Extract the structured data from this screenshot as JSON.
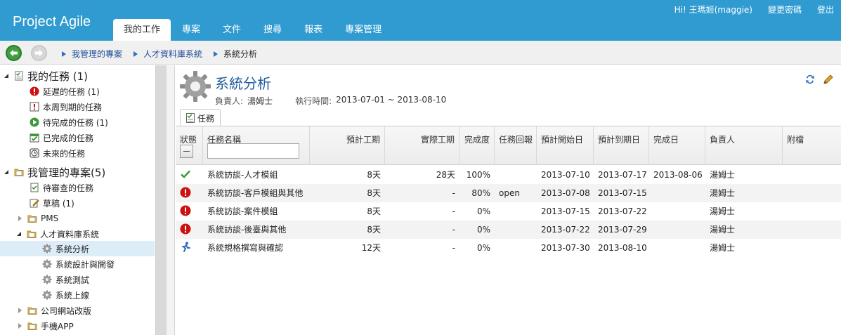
{
  "app": {
    "title": "Project Agile"
  },
  "user": {
    "greeting": "Hi! 王瑪姬(maggie)",
    "change_password": "變更密碼",
    "logout": "登出"
  },
  "tabs": [
    {
      "label": "我的工作",
      "active": true
    },
    {
      "label": "專案"
    },
    {
      "label": "文件"
    },
    {
      "label": "搜尋"
    },
    {
      "label": "報表"
    },
    {
      "label": "專案管理"
    }
  ],
  "breadcrumb": [
    "我管理的專案",
    "人才資料庫系統",
    "系統分析"
  ],
  "sidebar": {
    "my_tasks": "我的任務 (1)",
    "overdue": "延遲的任務 (1)",
    "due_this_week": "本周到期的任務",
    "todo": "待完成的任務 (1)",
    "done": "已完成的任務",
    "future": "未來的任務",
    "managed_projects": "我管理的專案(5)",
    "pending_review": "待審查的任務",
    "drafts": "草稿 (1)",
    "pms": "PMS",
    "talent_db": "人才資料庫系統",
    "analysis": "系統分析",
    "design_dev": "系統設計與開發",
    "testing": "系統測試",
    "launch": "系統上線",
    "website": "公司網站改版",
    "mobile_app": "手機APP"
  },
  "page": {
    "title": "系統分析",
    "owner_label": "負責人:",
    "owner": "湯姆士",
    "period_label": "執行時間:",
    "period": "2013-07-01 ~ 2013-08-10",
    "subtab": "任務"
  },
  "grid": {
    "headers": {
      "status": "狀態",
      "name": "任務名稱",
      "planned": "預計工期",
      "actual": "實際工期",
      "progress": "完成度",
      "report": "任務回報",
      "planned_start": "預計開始日",
      "planned_end": "預計到期日",
      "completed": "完成日",
      "owner": "負責人",
      "attachment": "附檔"
    },
    "rows": [
      {
        "status": "done",
        "name": "系統訪談-人才模組",
        "planned": "8天",
        "actual": "28天",
        "progress": "100%",
        "report": "",
        "start": "2013-07-10",
        "end": "2013-07-17",
        "completed": "2013-08-06",
        "owner": "湯姆士"
      },
      {
        "status": "overdue",
        "name": "系統訪談-客戶模組與其他",
        "planned": "8天",
        "actual": "-",
        "progress": "80%",
        "report": "open",
        "start": "2013-07-08",
        "end": "2013-07-15",
        "completed": "",
        "owner": "湯姆士"
      },
      {
        "status": "overdue",
        "name": "系統訪談-案件模組",
        "planned": "8天",
        "actual": "-",
        "progress": "0%",
        "report": "",
        "start": "2013-07-15",
        "end": "2013-07-22",
        "completed": "",
        "owner": "湯姆士"
      },
      {
        "status": "overdue",
        "name": "系統訪談-後臺與其他",
        "planned": "8天",
        "actual": "-",
        "progress": "0%",
        "report": "",
        "start": "2013-07-22",
        "end": "2013-07-29",
        "completed": "",
        "owner": "湯姆士"
      },
      {
        "status": "running",
        "name": "系統規格撰寫與確認",
        "planned": "12天",
        "actual": "-",
        "progress": "0%",
        "report": "",
        "start": "2013-07-30",
        "end": "2013-08-10",
        "completed": "",
        "owner": "湯姆士"
      }
    ]
  },
  "colors": {
    "header": "#2f9bd0",
    "title": "#1f5b9d",
    "overdue": "#cc1111",
    "done": "#3a9a3a",
    "link": "#1f4d99"
  }
}
